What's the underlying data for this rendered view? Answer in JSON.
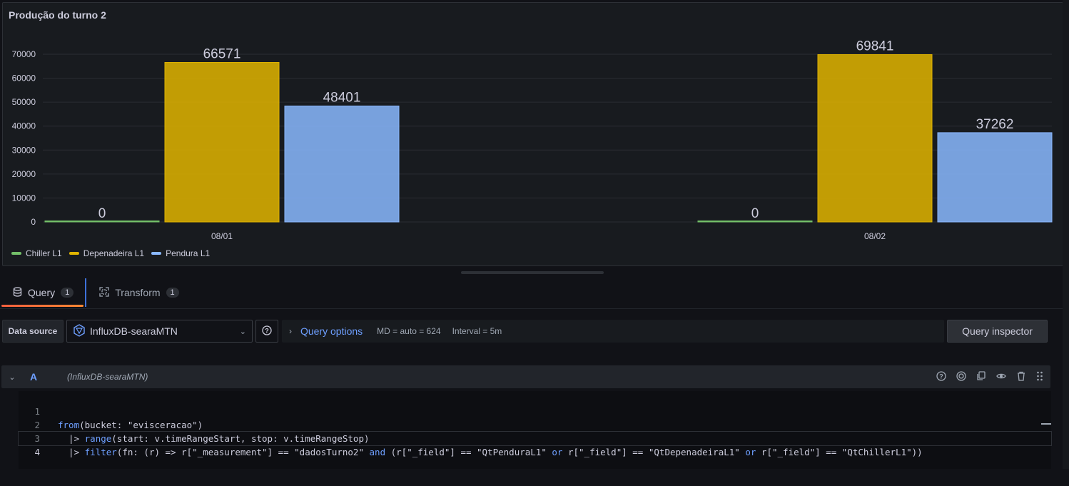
{
  "panel": {
    "title": "Produção do turno 2"
  },
  "chart_data": {
    "type": "bar",
    "title": "Produção do turno 2",
    "categories": [
      "08/01",
      "08/02"
    ],
    "series": [
      {
        "name": "Chiller L1",
        "values": [
          0,
          0
        ],
        "color": "#73bf69"
      },
      {
        "name": "Depenadeira L1",
        "values": [
          66571,
          69841
        ],
        "color": "#e0b400"
      },
      {
        "name": "Pendura L1",
        "values": [
          48401,
          37262
        ],
        "color": "#8ab8ff"
      }
    ],
    "ylim": [
      0,
      70000
    ],
    "yticks": [
      "0",
      "10000",
      "20000",
      "30000",
      "40000",
      "50000",
      "60000",
      "70000"
    ],
    "grid": true,
    "legend_placement": "bottom-left"
  },
  "tabs": [
    {
      "label": "Query",
      "count": "1",
      "icon": "database-icon"
    },
    {
      "label": "Transform",
      "count": "1",
      "icon": "transform-icon"
    }
  ],
  "toolbar": {
    "datasource_label": "Data source",
    "datasource_value": "InfluxDB-searaMTN",
    "query_options_label": "Query options",
    "md": "MD = auto = 624",
    "interval": "Interval = 5m",
    "inspector_label": "Query inspector"
  },
  "query": {
    "letter": "A",
    "datasource": "(InfluxDB-searaMTN)",
    "lines": [
      "1",
      "2",
      "3",
      "4"
    ]
  }
}
